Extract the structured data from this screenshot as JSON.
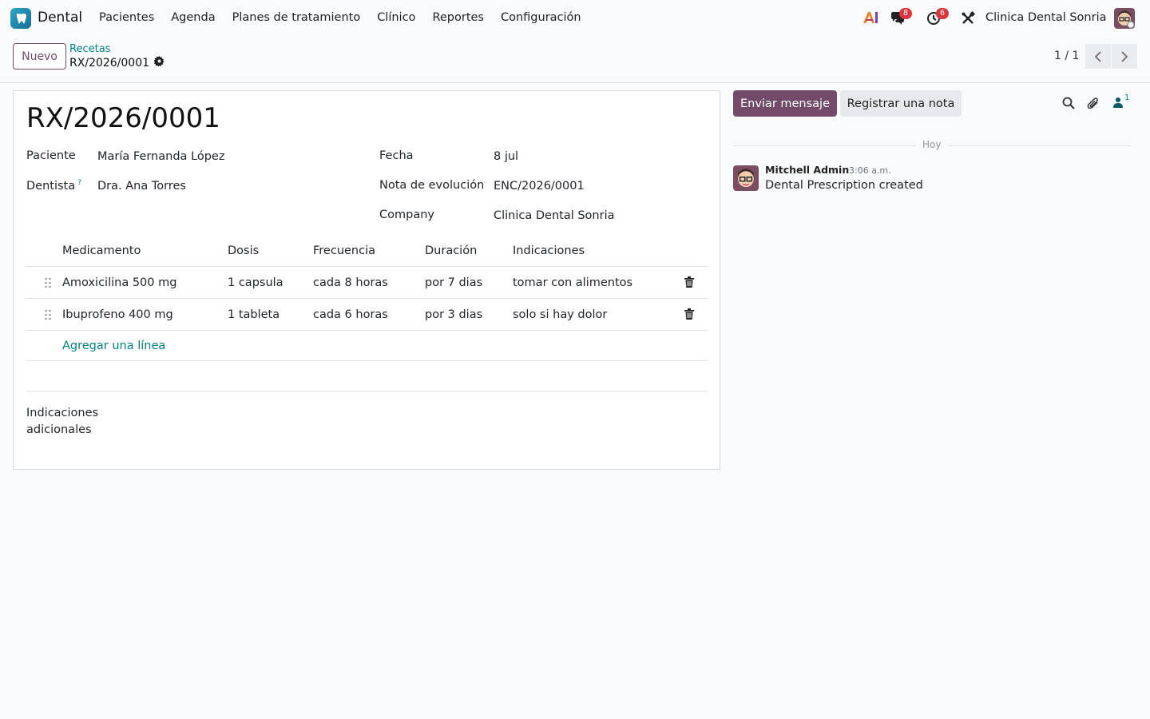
{
  "app": {
    "name": "Dental",
    "logo_icon": "tooth-icon"
  },
  "menu": [
    "Pacientes",
    "Agenda",
    "Planes de tratamiento",
    "Clínico",
    "Reportes",
    "Configuración"
  ],
  "systray": {
    "messages_count": "8",
    "activities_count": "6",
    "company": "Clinica Dental Sonria"
  },
  "control": {
    "new_button": "Nuevo",
    "breadcrumb_parent": "Recetas",
    "breadcrumb_current": "RX/2026/0001",
    "pager": "1 / 1"
  },
  "form": {
    "title": "RX/2026/0001",
    "fields": {
      "patient": {
        "label": "Paciente",
        "value": "María Fernanda López"
      },
      "dentist": {
        "label": "Dentista",
        "help": "?",
        "value": "Dra. Ana Torres"
      },
      "date": {
        "label": "Fecha",
        "value": "8 jul"
      },
      "note": {
        "label": "Nota de evolución",
        "value": "ENC/2026/0001"
      },
      "company": {
        "label": "Company",
        "value": "Clinica Dental Sonria"
      }
    },
    "lines": {
      "headers": [
        "Medicamento",
        "Dosis",
        "Frecuencia",
        "Duración",
        "Indicaciones"
      ],
      "rows": [
        [
          "Amoxicilina 500 mg",
          "1 capsula",
          "cada 8 horas",
          "por 7 dias",
          "tomar con alimentos"
        ],
        [
          "Ibuprofeno 400 mg",
          "1 tableta",
          "cada 6 horas",
          "por 3 dias",
          "solo si hay dolor"
        ]
      ],
      "add_line": "Agregar una línea"
    },
    "extra_label": "Indicaciones adicionales"
  },
  "chatter": {
    "send_button": "Enviar mensaje",
    "note_button": "Registrar una nota",
    "followers_count": "1",
    "day_separator": "Hoy",
    "message": {
      "author": "Mitchell Admin",
      "time": "3:06 a.m.",
      "body": "Dental Prescription created"
    }
  },
  "colors": {
    "primary": "#714b67",
    "link": "#017e84",
    "badge": "#d9363e"
  }
}
